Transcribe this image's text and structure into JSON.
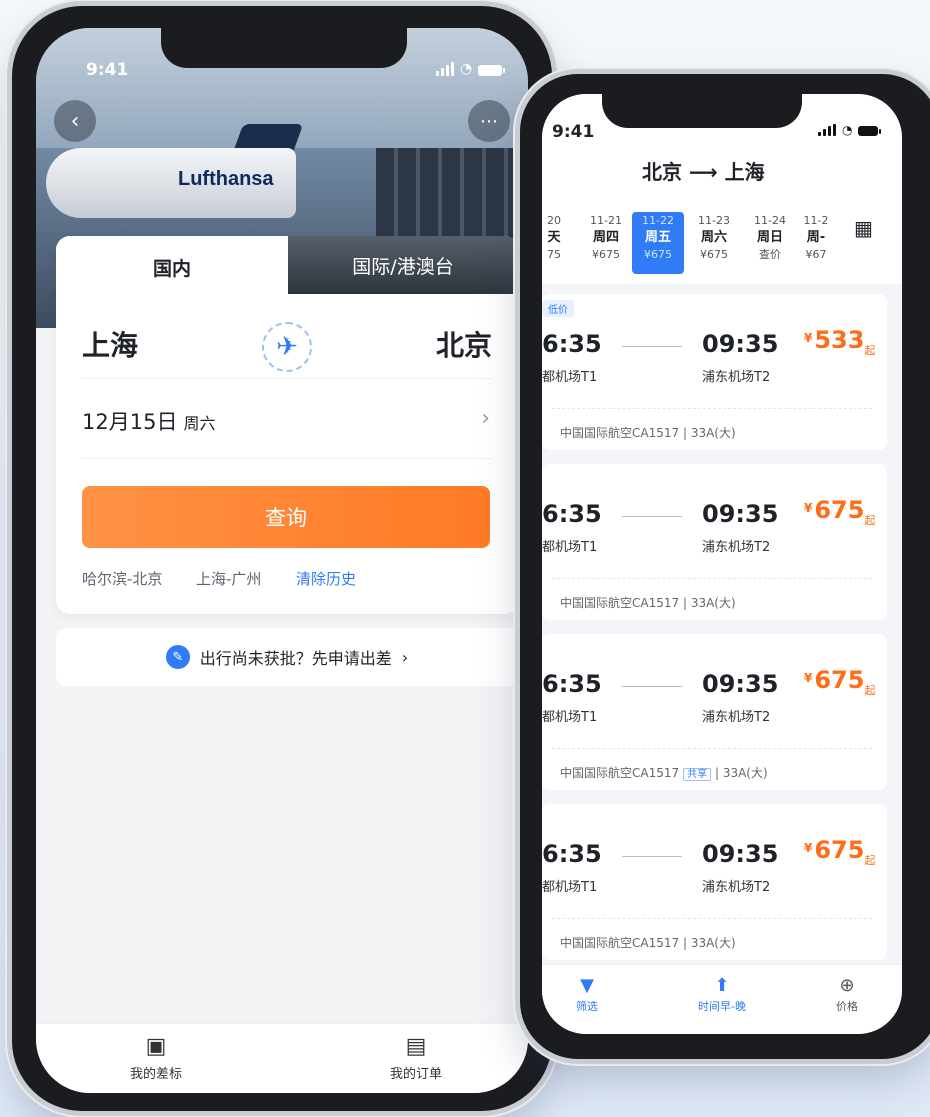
{
  "left": {
    "status_time": "9:41",
    "logo": "Lufthansa",
    "tabs": {
      "domestic": "国内",
      "international": "国际/港澳台"
    },
    "from_city": "上海",
    "to_city": "北京",
    "date": "12月15日",
    "weekday": "周六",
    "query_button": "查询",
    "history": [
      "哈尔滨-北京",
      "上海-广州"
    ],
    "clear_history": "清除历史",
    "apply_text": "出行尚未获批？先申请出差",
    "nav": {
      "trip_standard": "我的差标",
      "orders": "我的订单"
    }
  },
  "right": {
    "status_time": "9:41",
    "route_from": "北京",
    "route_to": "上海",
    "dates": [
      {
        "date": "20",
        "day": "天",
        "price": "75"
      },
      {
        "date": "11-21",
        "day": "周四",
        "price": "¥675"
      },
      {
        "date": "11-22",
        "day": "周五",
        "price": "¥675"
      },
      {
        "date": "11-23",
        "day": "周六",
        "price": "¥675"
      },
      {
        "date": "11-24",
        "day": "周日",
        "price": "查价"
      },
      {
        "date": "11-2",
        "day": "周-",
        "price": "¥67"
      }
    ],
    "low_price_tag": "低价",
    "flights": [
      {
        "dep": "6:35",
        "dep_airport": "都机场T1",
        "arr": "09:35",
        "arr_airport": "浦东机场T2",
        "currency": "¥",
        "price": "533",
        "suffix": "起",
        "airline": "中国国际航空CA1517",
        "seat": "33A(大)",
        "shared": ""
      },
      {
        "dep": "6:35",
        "dep_airport": "都机场T1",
        "arr": "09:35",
        "arr_airport": "浦东机场T2",
        "currency": "¥",
        "price": "675",
        "suffix": "起",
        "airline": "中国国际航空CA1517",
        "seat": "33A(大)",
        "shared": ""
      },
      {
        "dep": "6:35",
        "dep_airport": "都机场T1",
        "arr": "09:35",
        "arr_airport": "浦东机场T2",
        "currency": "¥",
        "price": "675",
        "suffix": "起",
        "airline": "中国国际航空CA1517",
        "seat": "33A(大)",
        "shared": "共享"
      },
      {
        "dep": "6:35",
        "dep_airport": "都机场T1",
        "arr": "09:35",
        "arr_airport": "浦东机场T2",
        "currency": "¥",
        "price": "675",
        "suffix": "起",
        "airline": "中国国际航空CA1517",
        "seat": "33A(大)",
        "shared": ""
      }
    ],
    "nav": {
      "filter": "筛选",
      "time_sort": "时间早-晚",
      "price": "价格"
    }
  },
  "colors": {
    "accent_blue": "#2f7cf6",
    "accent_orange": "#ff7a25"
  }
}
